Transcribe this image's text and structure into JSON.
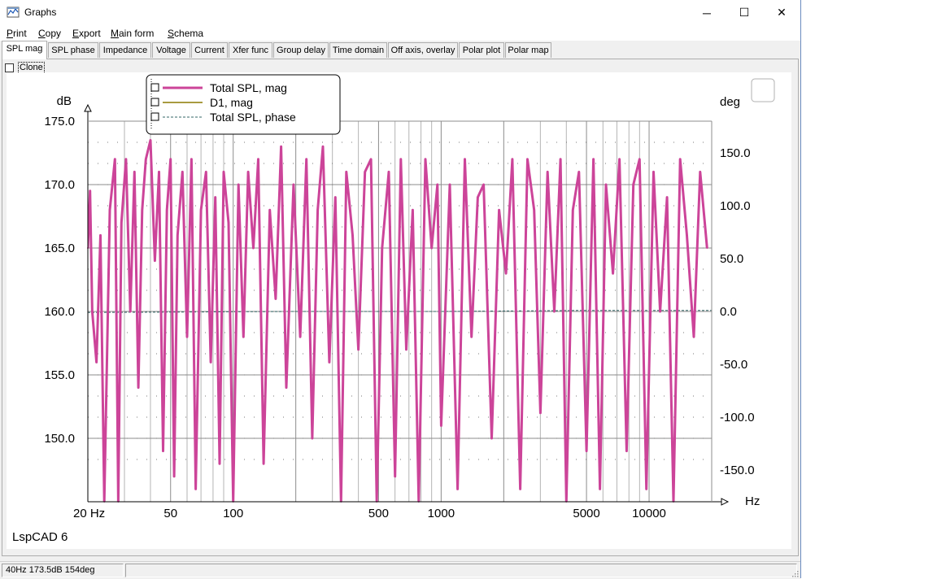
{
  "window": {
    "title": "Graphs",
    "icon": "graph-app-icon",
    "controls": {
      "minimize": "─",
      "maximize": "☐",
      "close": "✕"
    }
  },
  "menu": [
    {
      "label": "Print",
      "underline": "P",
      "rest": "rint"
    },
    {
      "label": "Copy",
      "underline": "C",
      "rest": "opy"
    },
    {
      "label": "Export",
      "underline": "E",
      "rest": "xport"
    },
    {
      "label": "Main form",
      "underline": "M",
      "rest": "ain form"
    },
    {
      "label": "Schema",
      "underline": "S",
      "rest": "chema"
    }
  ],
  "tabs": [
    "SPL mag",
    "SPL phase",
    "Impedance",
    "Voltage",
    "Current",
    "Xfer func",
    "Group delay",
    "Time domain",
    "Off axis, overlay",
    "Polar plot",
    "Polar map"
  ],
  "active_tab": 0,
  "clone": {
    "label": "Clone",
    "checked": false
  },
  "watermark": "LspCAD 6",
  "status": {
    "readout": "40Hz 173.5dB 154deg",
    "pane2": ""
  },
  "colors": {
    "spl": "#cc4499",
    "d1": "#8b7a00",
    "phase": "#336666",
    "grid": "#8c8c8c"
  },
  "chart_data": {
    "type": "line",
    "xscale": "log",
    "xlim": [
      20,
      20000
    ],
    "ylim": [
      145,
      175
    ],
    "y2lim": [
      -180,
      180
    ],
    "xlabel": "Hz",
    "ylabel": "dB",
    "y2label": "deg",
    "x_ticks": [
      "20 Hz",
      "50",
      "100",
      "500",
      "1000",
      "5000",
      "10000"
    ],
    "x_tick_values": [
      20,
      50,
      100,
      500,
      1000,
      5000,
      10000
    ],
    "y_ticks": [
      "150.0",
      "155.0",
      "160.0",
      "165.0",
      "170.0",
      "175.0"
    ],
    "y_tick_values": [
      150,
      155,
      160,
      165,
      170,
      175
    ],
    "y2_ticks": [
      "-150.0",
      "-100.0",
      "-50.0",
      "0.0",
      "50.0",
      "100.0",
      "150.0"
    ],
    "y2_tick_values": [
      -150,
      -100,
      -50,
      0,
      50,
      100,
      150
    ],
    "legend_position": "top-left",
    "grid": true,
    "series": [
      {
        "name": "Total SPL, mag",
        "axis": "left",
        "x": [
          20,
          20.5,
          21,
          22,
          23,
          24,
          25.5,
          27,
          28,
          29,
          30.5,
          32,
          33.5,
          35,
          36.5,
          38,
          40,
          42,
          44,
          46,
          48,
          50,
          52,
          54,
          57,
          60,
          63,
          66,
          70,
          74,
          78,
          82,
          86,
          90,
          95,
          100,
          106,
          112,
          118,
          125,
          132,
          140,
          150,
          160,
          170,
          180,
          195,
          210,
          225,
          240,
          255,
          270,
          290,
          310,
          330,
          350,
          375,
          400,
          430,
          460,
          490,
          520,
          560,
          600,
          640,
          680,
          730,
          780,
          840,
          900,
          960,
          1000,
          1100,
          1200,
          1300,
          1400,
          1500,
          1600,
          1750,
          1900,
          2050,
          2200,
          2400,
          2600,
          2800,
          3000,
          3250,
          3500,
          3750,
          4000,
          4300,
          4600,
          5000,
          5400,
          5800,
          6200,
          6700,
          7200,
          7800,
          8400,
          9000,
          9700,
          10500,
          11300,
          12200,
          13100,
          14100,
          15200,
          16400,
          17600,
          19000
        ],
        "y": [
          165,
          169.5,
          160,
          156,
          166,
          145,
          168,
          172,
          145,
          167,
          172,
          160,
          171,
          154,
          168,
          172,
          173.5,
          164,
          171,
          149,
          168,
          172,
          147,
          166,
          171,
          158,
          172,
          146,
          168,
          171,
          156,
          169,
          148,
          171,
          167,
          145,
          170,
          158,
          171,
          165,
          172,
          148,
          168,
          161,
          173,
          154,
          170,
          158,
          172,
          150,
          168,
          173,
          156,
          169,
          145,
          171,
          166,
          157,
          171,
          172,
          145,
          165,
          171,
          147,
          172,
          157,
          168,
          145,
          172,
          165,
          170,
          151,
          170,
          146,
          172,
          158,
          169,
          170,
          150,
          168,
          163,
          172,
          146,
          172,
          168,
          152,
          171,
          160,
          172,
          145,
          168,
          171,
          149,
          172,
          146,
          170,
          163,
          172,
          149,
          170,
          172,
          146,
          171,
          160,
          169,
          145,
          172,
          166,
          158,
          171,
          165
        ]
      },
      {
        "name": "D1, mag",
        "axis": "left",
        "x": [],
        "y": []
      },
      {
        "name": "Total SPL, phase",
        "axis": "right",
        "x": [
          20,
          200,
          1000,
          5000,
          10000,
          20000
        ],
        "y": [
          -1,
          0,
          0,
          1,
          1,
          1
        ]
      }
    ]
  }
}
